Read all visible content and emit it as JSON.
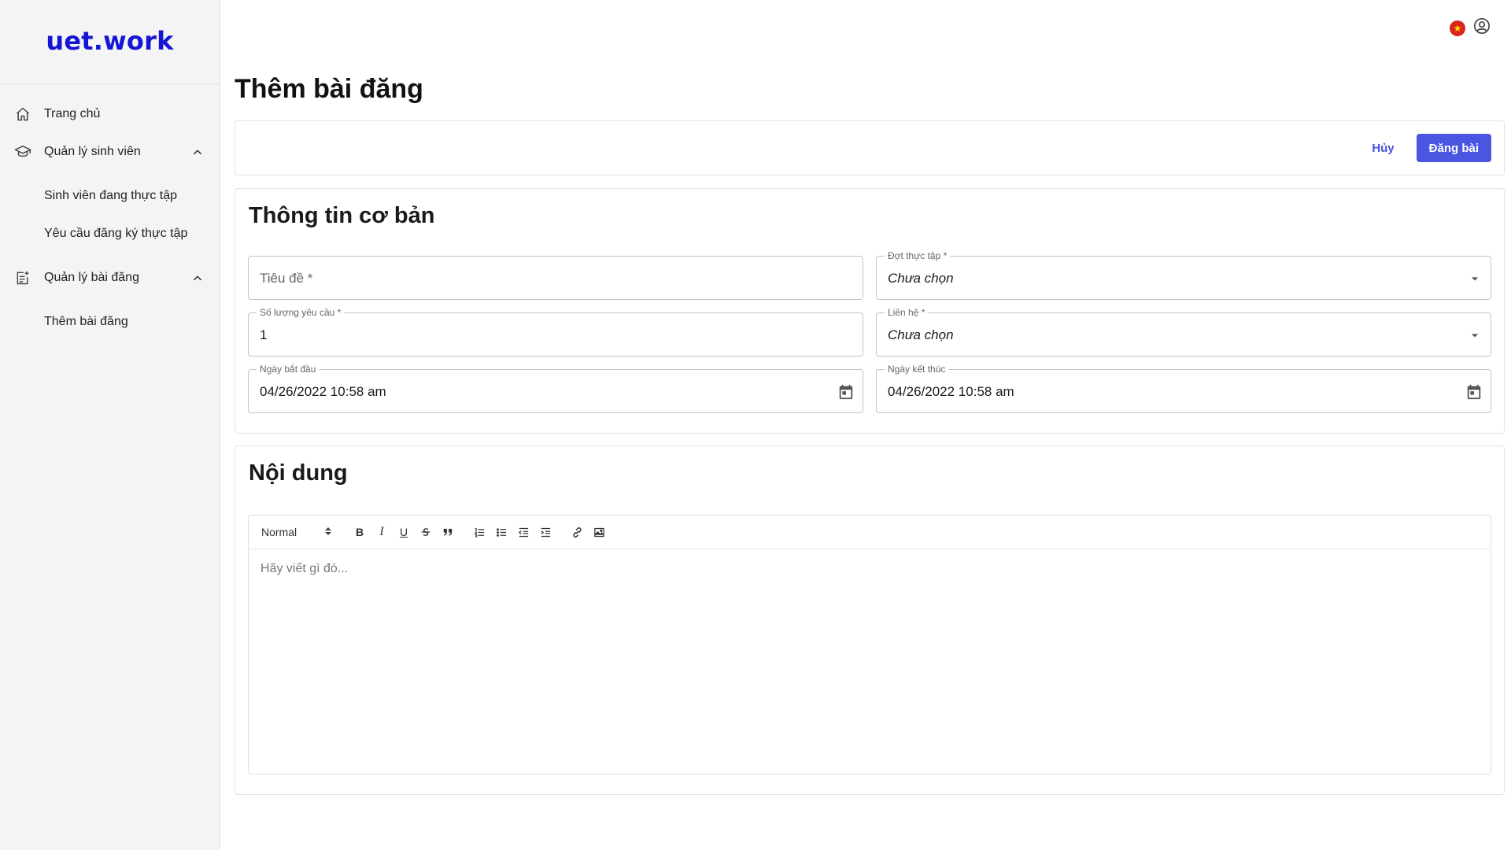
{
  "app": {
    "logo": "uet.work"
  },
  "sidebar": {
    "items": [
      {
        "label": "Trang chủ",
        "icon": "home-icon"
      },
      {
        "label": "Quản lý sinh viên",
        "icon": "graduation-cap-icon",
        "expanded": true,
        "children": [
          {
            "label": "Sinh viên đang thực tập"
          },
          {
            "label": "Yêu cầu đăng ký thực tập"
          }
        ]
      },
      {
        "label": "Quản lý bài đăng",
        "icon": "post-add-icon",
        "expanded": true,
        "children": [
          {
            "label": "Thêm bài đăng"
          }
        ]
      }
    ]
  },
  "header": {
    "flag_icon": "vietnam-flag-icon",
    "account_icon": "account-circle-icon"
  },
  "page": {
    "title": "Thêm bài đăng"
  },
  "actions": {
    "cancel_label": "Hủy",
    "submit_label": "Đăng bài",
    "primary_color": "#4a56e2"
  },
  "basic_info": {
    "title": "Thông tin cơ bản",
    "fields": {
      "tieu_de": {
        "placeholder": "Tiêu đề *",
        "value": ""
      },
      "dot_thuc_tap": {
        "label": "Đợt thực tập *",
        "value": "Chưa chọn"
      },
      "so_luong": {
        "label": "Số lượng yêu cầu *",
        "value": "1"
      },
      "lien_he": {
        "label": "Liên hệ *",
        "value": "Chưa chọn"
      },
      "ngay_bat_dau": {
        "label": "Ngày bắt đầu",
        "value": "04/26/2022 10:58 am"
      },
      "ngay_ket_thuc": {
        "label": "Ngày kết thúc",
        "value": "04/26/2022 10:58 am"
      }
    }
  },
  "content": {
    "title": "Nội dung",
    "toolbar": {
      "format_select": "Normal",
      "buttons": [
        "B",
        "I",
        "U"
      ]
    },
    "editor_placeholder": "Hãy viết gì đó..."
  }
}
